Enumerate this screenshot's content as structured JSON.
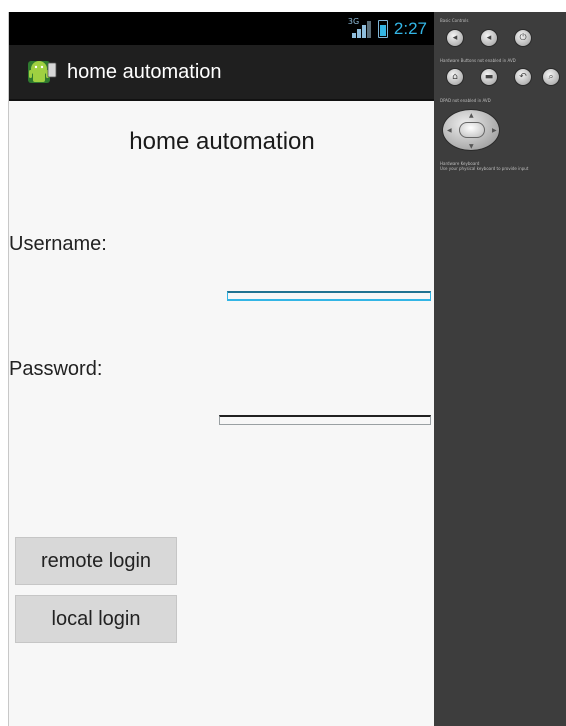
{
  "status_bar": {
    "network": "3G",
    "time": "2:27"
  },
  "action_bar": {
    "title": "home automation",
    "icon": "android-app-icon"
  },
  "form": {
    "heading": "home automation",
    "username_label": "Username:",
    "username_value": "",
    "password_label": "Password:",
    "password_value": ""
  },
  "buttons": {
    "remote_login": "remote login",
    "local_login": "local login"
  },
  "emulator_panel": {
    "basic_controls_label": "Basic Controls",
    "hardware_buttons_label": "Hardware Buttons",
    "hardware_buttons_note": "not enabled in AVD",
    "dpad_label": "DPAD",
    "dpad_note": "not enabled in AVD",
    "keyboard_label": "Hardware Keyboard",
    "keyboard_note": "Use your physical keyboard to provide input",
    "icons": [
      "volume-down-icon",
      "volume-up-icon",
      "power-icon",
      "home-icon",
      "menu-icon",
      "back-icon",
      "search-icon"
    ]
  },
  "colors": {
    "accent": "#33b5e5",
    "action_bar": "#1f1f1f",
    "panel": "#3d3d3d"
  }
}
